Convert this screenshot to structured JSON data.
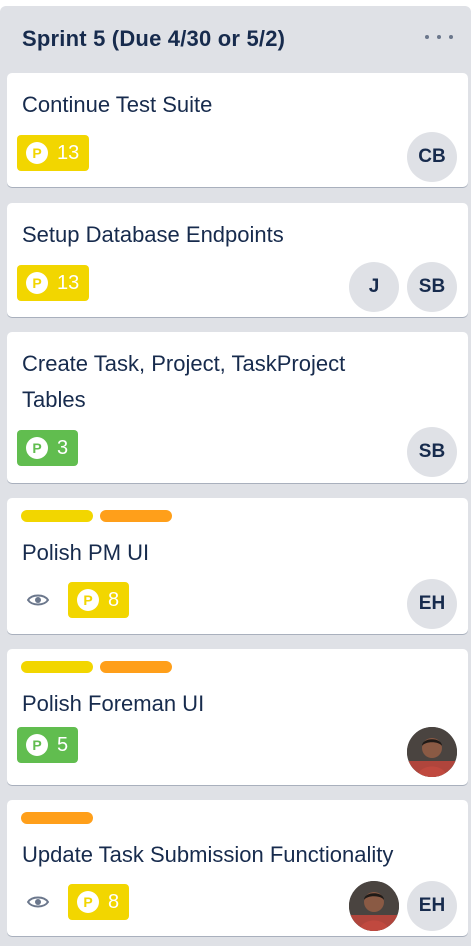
{
  "list": {
    "title": "Sprint 5 (Due 4/30 or 5/2)",
    "menu_icon": "more-horizontal-icon"
  },
  "cards": [
    {
      "title": "Continue Test Suite",
      "labels": [],
      "points": "13",
      "points_color": "#f2d600",
      "watched": false,
      "members": [
        "CB"
      ]
    },
    {
      "title": "Setup Database Endpoints",
      "labels": [],
      "points": "13",
      "points_color": "#f2d600",
      "watched": false,
      "members": [
        "J",
        "SB"
      ]
    },
    {
      "title_line1": "Create Task, Project, TaskProject",
      "title_line2": "Tables",
      "labels": [],
      "points": "3",
      "points_color": "#61bd4f",
      "watched": false,
      "members": [
        "SB"
      ]
    },
    {
      "title": "Polish PM UI",
      "labels": [
        "#f2d600",
        "#ff9f1a"
      ],
      "points": "8",
      "points_color": "#f2d600",
      "watched": true,
      "members": [
        "EH"
      ]
    },
    {
      "title": "Polish Foreman UI",
      "labels": [
        "#f2d600",
        "#ff9f1a"
      ],
      "points": "5",
      "points_color": "#61bd4f",
      "watched": false,
      "members": [
        "photo-avatar"
      ]
    },
    {
      "title": "Update Task Submission Functionality",
      "labels": [
        "#ff9f1a"
      ],
      "points": "8",
      "points_color": "#f2d600",
      "watched": true,
      "members": [
        "photo-avatar",
        "EH"
      ]
    }
  ],
  "points_icon_letter": "P",
  "watch_icon": "eye-icon"
}
